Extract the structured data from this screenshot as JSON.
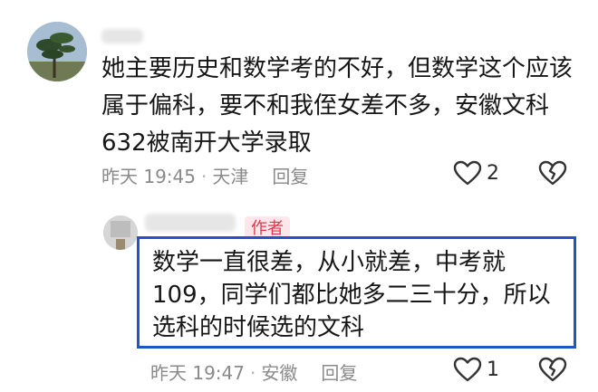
{
  "comment": {
    "text": "她主要历史和数学考的不好，但数学这个应该属于偏科，要不和我侄女差不多，安徽文科632被南开大学录取",
    "time": "昨天 19:45",
    "location": "天津",
    "reply_label": "回复",
    "like_count": "2"
  },
  "reply": {
    "badge": "作者",
    "text": "数学一直很差，从小就差，中考就109，同学们都比她多二三十分，所以选科的时候选的文科",
    "time": "昨天 19:47",
    "location": "安徽",
    "reply_label": "回复",
    "like_count": "1"
  },
  "colors": {
    "highlight_box": "#1f55c7",
    "author_badge": "#e2364b"
  }
}
